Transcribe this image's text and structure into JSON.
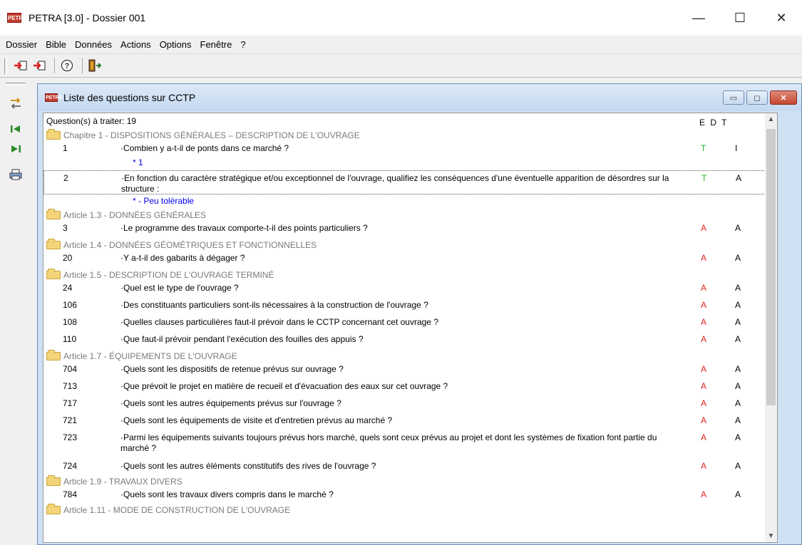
{
  "window": {
    "title": "PETRA [3.0] - Dossier 001",
    "icon": "PETRA"
  },
  "window_controls": {
    "minimize": "—",
    "maximize": "☐",
    "close": "✕"
  },
  "menu": [
    "Dossier",
    "Bible",
    "Données",
    "Actions",
    "Options",
    "Fenêtre",
    "?"
  ],
  "toolbar": {
    "icons": [
      "import-icon",
      "export-icon",
      "help-icon",
      "exit-icon"
    ]
  },
  "left_toolbar": {
    "icons": [
      "transfer-icon",
      "first-icon",
      "last-icon",
      "print-icon"
    ]
  },
  "child": {
    "title": "Liste des questions sur CCTP",
    "icon": "PETRA",
    "controls": {
      "minimize": "▭",
      "maximize": "◻",
      "close": "✕"
    }
  },
  "list": {
    "count_label": "Question(s) à traiter: 19",
    "columns": "E D T",
    "rows": [
      {
        "type": "chapter",
        "text": "Chapitre 1 - DISPOSITIONS GÉNÉRALES – DESCRIPTION DE L'OUVRAGE"
      },
      {
        "type": "question",
        "num": "1",
        "text": "·Combien y a-t-il de ponts dans ce marché ?",
        "e": "T",
        "e_color": "green",
        "t": "I"
      },
      {
        "type": "answer",
        "text": "* 1"
      },
      {
        "type": "question",
        "num": "2",
        "text": "·En fonction du caractère stratégique et/ou exceptionnel de l'ouvrage, qualifiez les conséquences d'une éventuelle apparition de désordres sur la structure :",
        "e": "T",
        "e_color": "green",
        "t": "A",
        "selected": true
      },
      {
        "type": "answer",
        "text": "* - Peu tolérable"
      },
      {
        "type": "chapter",
        "text": "Article 1.3 - DONNÉES GÉNÉRALES"
      },
      {
        "type": "question",
        "num": "3",
        "text": "·Le programme des travaux comporte-t-il des points particuliers ?",
        "e": "A",
        "e_color": "red",
        "t": "A"
      },
      {
        "type": "chapter",
        "text": "Article 1.4 - DONNÉES GÉOMÉTRIQUES ET FONCTIONNELLES"
      },
      {
        "type": "question",
        "num": "20",
        "text": "·Y a-t-il des gabarits à dégager ?",
        "e": "A",
        "e_color": "red",
        "t": "A"
      },
      {
        "type": "chapter",
        "text": "Article 1.5 - DESCRIPTION DE L'OUVRAGE TERMINÉ"
      },
      {
        "type": "question",
        "num": "24",
        "text": "·Quel est le type de l'ouvrage ?",
        "e": "A",
        "e_color": "red",
        "t": "A"
      },
      {
        "type": "question",
        "num": "106",
        "text": "·Des constituants particuliers sont-ils nécessaires à la construction de l'ouvrage ?",
        "e": "A",
        "e_color": "red",
        "t": "A"
      },
      {
        "type": "question",
        "num": "108",
        "text": "·Quelles clauses particulières faut-il prévoir dans le CCTP concernant cet ouvrage ?",
        "e": "A",
        "e_color": "red",
        "t": "A"
      },
      {
        "type": "question",
        "num": "110",
        "text": "·Que faut-il prévoir pendant l'exécution des fouilles des appuis ?",
        "e": "A",
        "e_color": "red",
        "t": "A"
      },
      {
        "type": "chapter",
        "text": "Article 1.7 - ÉQUIPEMENTS DE L'OUVRAGE"
      },
      {
        "type": "question",
        "num": "704",
        "text": "·Quels sont les dispositifs de retenue prévus sur ouvrage ?",
        "e": "A",
        "e_color": "red",
        "t": "A"
      },
      {
        "type": "question",
        "num": "713",
        "text": "·Que prévoit le projet en matière de recueil et d'évacuation des eaux sur cet ouvrage ?",
        "e": "A",
        "e_color": "red",
        "t": "A"
      },
      {
        "type": "question",
        "num": "717",
        "text": "·Quels sont les autres équipements prévus sur l'ouvrage ?",
        "e": "A",
        "e_color": "red",
        "t": "A"
      },
      {
        "type": "question",
        "num": "721",
        "text": "·Quels sont les équipements de visite et d'entretien prévus au marché ?",
        "e": "A",
        "e_color": "red",
        "t": "A"
      },
      {
        "type": "question",
        "num": "723",
        "text": "·Parmi les équipements suivants toujours prévus hors marché, quels sont ceux prévus au projet et dont les systèmes de fixation font partie du marché ?",
        "e": "A",
        "e_color": "red",
        "t": "A"
      },
      {
        "type": "question",
        "num": "724",
        "text": "·Quels sont les autres éléments constitutifs des rives de l'ouvrage ?",
        "e": "A",
        "e_color": "red",
        "t": "A"
      },
      {
        "type": "chapter",
        "text": "Article 1.9 - TRAVAUX DIVERS"
      },
      {
        "type": "question",
        "num": "784",
        "text": "·Quels sont les travaux divers compris dans le marché ?",
        "e": "A",
        "e_color": "red",
        "t": "A"
      },
      {
        "type": "chapter",
        "text": "Article 1.11 - MODE DE CONSTRUCTION DE L'OUVRAGE"
      }
    ]
  }
}
